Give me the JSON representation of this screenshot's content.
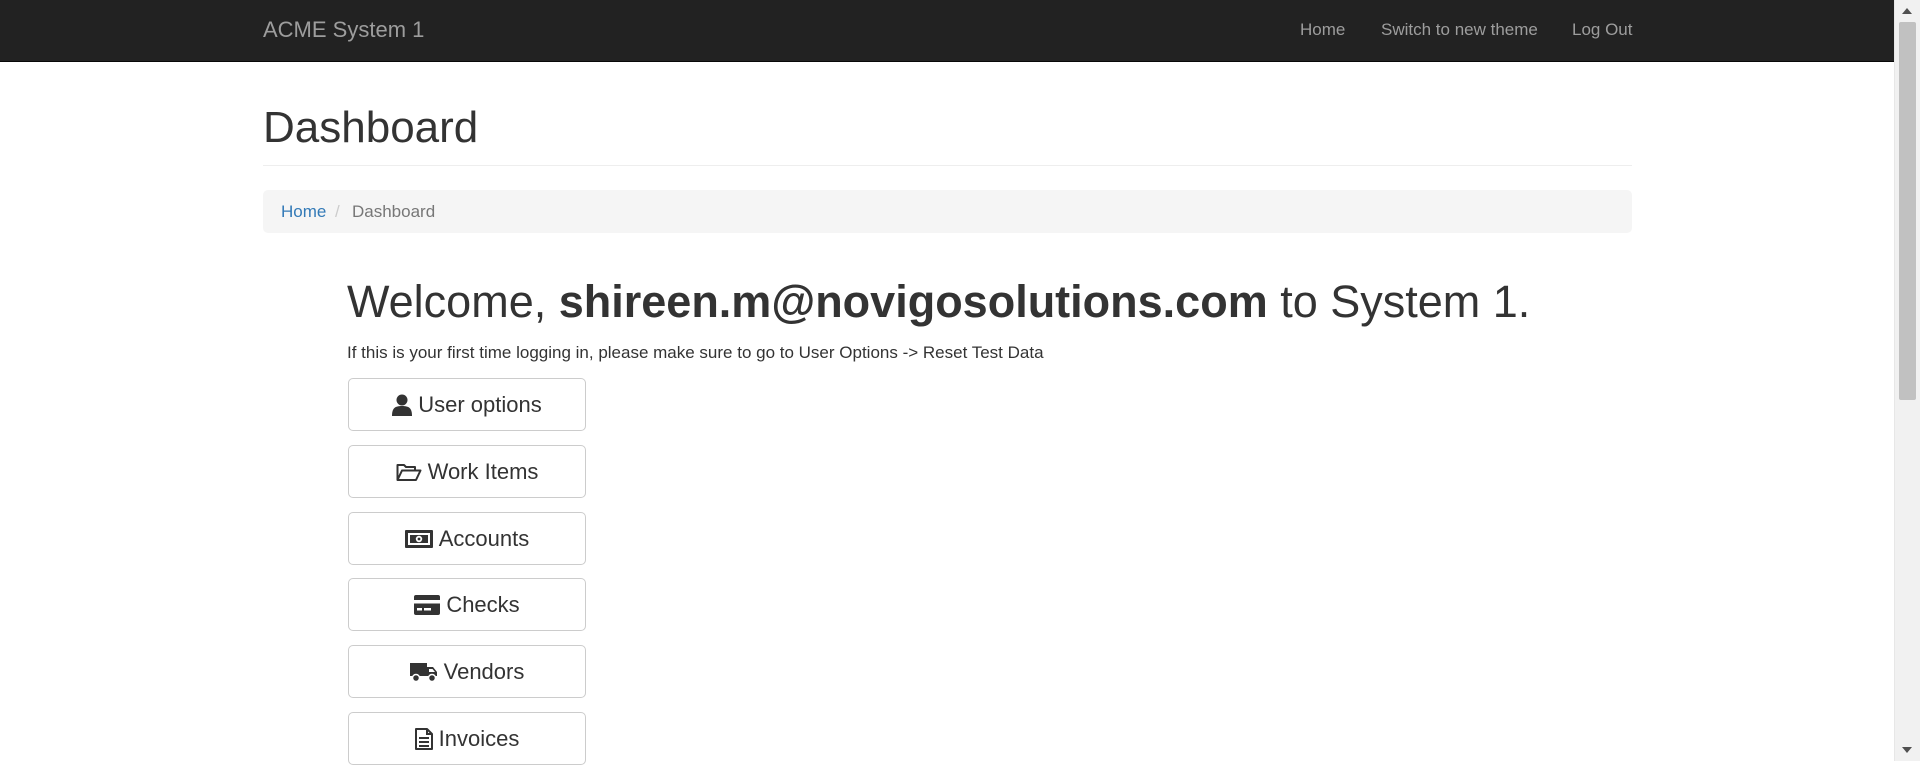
{
  "navbar": {
    "brand": "ACME System 1",
    "links": [
      "Home",
      "Switch to new theme",
      "Log Out"
    ]
  },
  "page": {
    "title": "Dashboard"
  },
  "breadcrumb": {
    "home": "Home",
    "separator": "/",
    "current": "Dashboard"
  },
  "welcome": {
    "prefix": "Welcome, ",
    "user": "shireen.m@novigosolutions.com",
    "suffix": " to System 1.",
    "hint": "If this is your first time logging in, please make sure to go to User Options -> Reset Test Data"
  },
  "menu": [
    {
      "label": "User options",
      "icon": "user-icon"
    },
    {
      "label": "Work Items",
      "icon": "folder-open-icon"
    },
    {
      "label": "Accounts",
      "icon": "money-icon"
    },
    {
      "label": "Checks",
      "icon": "credit-card-icon"
    },
    {
      "label": "Vendors",
      "icon": "truck-icon"
    },
    {
      "label": "Invoices",
      "icon": "file-text-icon"
    }
  ],
  "colors": {
    "navbar_bg": "#222222",
    "nav_text": "#9d9d9d",
    "link": "#337ab7",
    "breadcrumb_bg": "#f5f5f5"
  }
}
